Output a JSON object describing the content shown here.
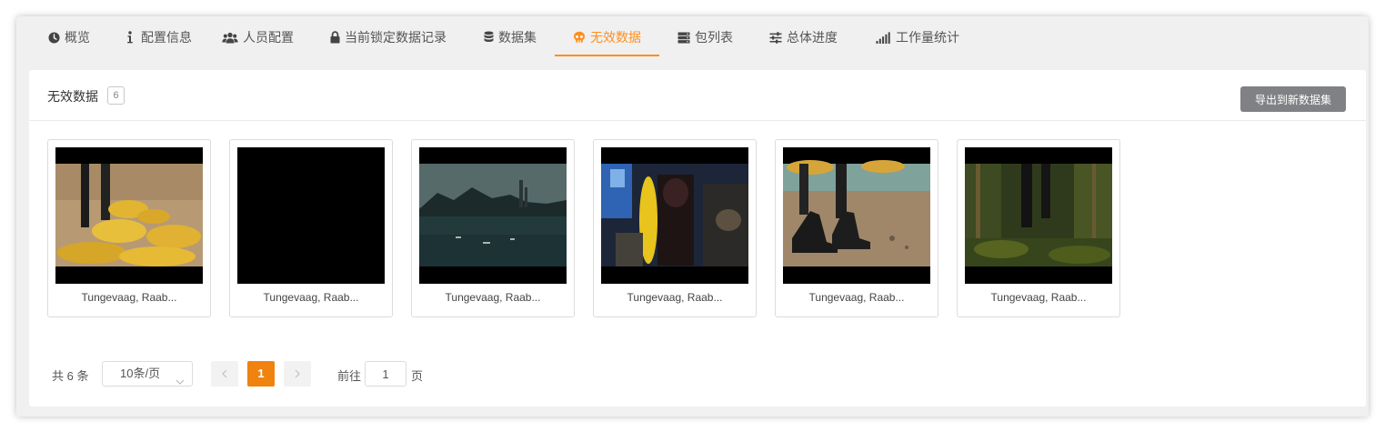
{
  "tabs": [
    {
      "label": "概览",
      "icon": "clock-icon"
    },
    {
      "label": "配置信息",
      "icon": "info-icon"
    },
    {
      "label": "人员配置",
      "icon": "users-icon"
    },
    {
      "label": "当前锁定数据记录",
      "icon": "lock-icon"
    },
    {
      "label": "数据集",
      "icon": "database-icon"
    },
    {
      "label": "无效数据",
      "icon": "skull-icon",
      "active": true
    },
    {
      "label": "包列表",
      "icon": "server-icon"
    },
    {
      "label": "总体进度",
      "icon": "sliders-icon"
    },
    {
      "label": "工作量统计",
      "icon": "signal-bars-icon"
    }
  ],
  "panel": {
    "title": "无效数据",
    "count": "6",
    "export_label": "导出到新数据集"
  },
  "items": [
    {
      "label": "Tungevaag, Raab...",
      "thumbnail": "yellow-inflatables-on-sand"
    },
    {
      "label": "Tungevaag, Raab...",
      "thumbnail": "black-frame"
    },
    {
      "label": "Tungevaag, Raab...",
      "thumbnail": "harbor-at-dusk"
    },
    {
      "label": "Tungevaag, Raab...",
      "thumbnail": "crowd-night-scene"
    },
    {
      "label": "Tungevaag, Raab...",
      "thumbnail": "boots-on-beach"
    },
    {
      "label": "Tungevaag, Raab...",
      "thumbnail": "forest-walk"
    }
  ],
  "pagination": {
    "total_text": "共 6 条",
    "page_size": "10条/页",
    "current_page": "1",
    "goto_label": "前往",
    "goto_value": "1",
    "page_suffix": "页"
  },
  "colors": {
    "accent": "#ff8f1f",
    "active_page": "#f0820f",
    "export_button": "#808184"
  }
}
